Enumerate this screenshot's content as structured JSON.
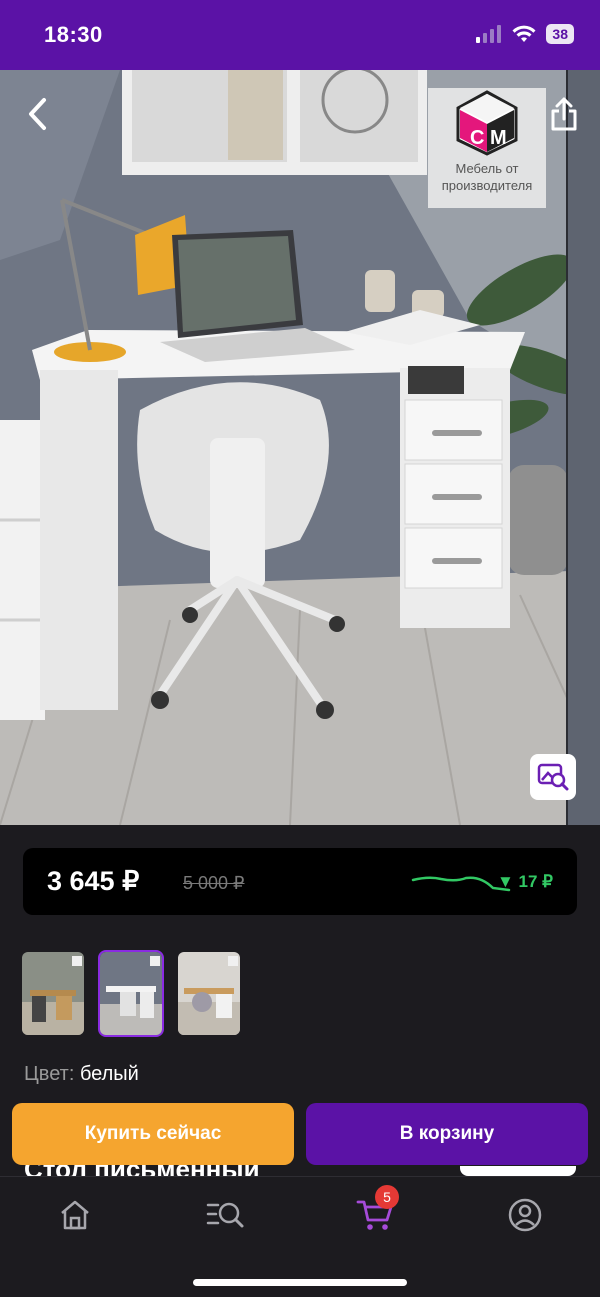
{
  "status_bar": {
    "time": "18:30",
    "battery": "38",
    "icons": [
      "signal-icon",
      "wifi-icon",
      "battery-icon"
    ]
  },
  "header": {
    "back_icon": "chevron-left-icon",
    "share_icon": "share-icon",
    "brand_logo_text": "Мебель от производителя"
  },
  "product": {
    "price_current": "3 645 ₽",
    "price_old": "5 000 ₽",
    "price_drop": "▼ 17 ₽",
    "color_label": "Цвет:",
    "color_value": "белый",
    "title": "Стол письменный",
    "thumbnails": [
      "thumb-1",
      "thumb-2",
      "thumb-3"
    ],
    "selected_thumbnail": 2
  },
  "actions": {
    "buy_now": "Купить сейчас",
    "add_to_cart": "В корзину"
  },
  "tab_bar": {
    "items": [
      "home-icon",
      "catalog-search-icon",
      "cart-icon",
      "profile-icon"
    ],
    "active": "cart-icon",
    "cart_badge": "5"
  },
  "colors": {
    "brand_purple": "#5b12a6",
    "active_tab": "#a64bd9",
    "buy_orange": "#f5a52f",
    "price_green": "#32c864",
    "badge_red": "#e53935",
    "background": "#1c1b1f"
  }
}
